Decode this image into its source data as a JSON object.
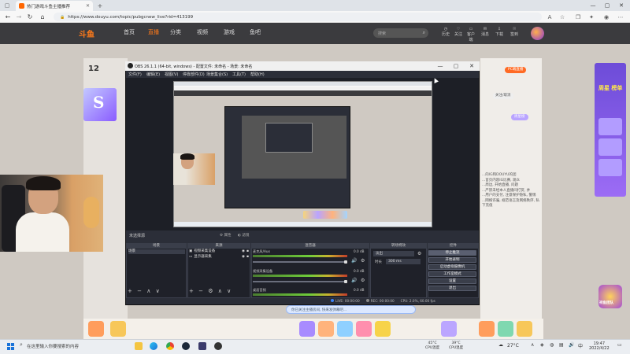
{
  "browser": {
    "tab_title": "热门游戏斗鱼主播推荐",
    "url": "https://www.douyu.com/topic/pubgcnew_live?rid=413199",
    "icons": [
      "back-icon",
      "forward-icon",
      "refresh-icon",
      "home-icon",
      "read-aloud-icon",
      "favorite-icon",
      "collections-icon",
      "extensions-icon",
      "profile-icon",
      "more-icon"
    ]
  },
  "douyu": {
    "logo": "斗鱼",
    "nav": [
      "首页",
      "直播",
      "分类",
      "视频",
      "游戏",
      "鱼吧"
    ],
    "search_placeholder": "搜索",
    "header_icons": [
      "历史",
      "关注",
      "客户端",
      "消息",
      "下载",
      "签到"
    ],
    "room_number": "12",
    "room_sub": "",
    "pc_live_label": "PC端直播",
    "follow_label": "关注/取消",
    "weekly_label": "周星榜",
    "rank_title": "周星 榜单",
    "side_text": [
      "...的IG和DOUYU的团",
      "...首页内容IG比赛, 观众",
      "...周边, 开始直播, 问题",
      "...严禁未经本人直播间打赏, 并",
      "...用户的支付, 注意保护隐私, 警惕",
      "...网络诈骗, 规范语言及网络秩序, 私下充值"
    ],
    "danmu_text": "你已关注主播房间, 快来发弹幕吧...",
    "badge_text": "祥鱼团队"
  },
  "obs": {
    "title": "OBS 26.1.1 (64-bit, windows) - 配置文件: 未命名 - 场景: 未命名",
    "menu": [
      "文件(F)",
      "编辑(E)",
      "视图(V)",
      "停靠部件(D)",
      "场景集合(S)",
      "工具(T)",
      "帮助(H)"
    ],
    "no_source": "未选择源",
    "properties_label": "属性",
    "filters_label": "滤镜",
    "docks": {
      "scenes": {
        "title": "场景",
        "items": [
          "场景"
        ]
      },
      "sources": {
        "title": "来源",
        "items": [
          "视频采集设备",
          "显示器采集"
        ]
      },
      "mixer": {
        "title": "混音器",
        "channels": [
          {
            "name": "麦克风/Aux",
            "db": "0.0 dB"
          },
          {
            "name": "视频采集设备",
            "db": "0.0 dB"
          },
          {
            "name": "桌面音频",
            "db": "0.0 dB"
          }
        ]
      },
      "transitions": {
        "title": "转场特效",
        "type": "淡出",
        "duration_label": "时长",
        "duration_value": "300 ms"
      },
      "controls": {
        "title": "控件",
        "buttons": [
          "停止推流",
          "开始录制",
          "启动虚拟摄像机",
          "工作室模式",
          "设置",
          "退出"
        ]
      }
    },
    "status": {
      "live": "LIVE: 00:00:00",
      "rec": "REC: 00:00:00",
      "cpu": "CPU: 2.0%, 60.00 fps"
    }
  },
  "taskbar": {
    "search_text": "在这里输入你要搜索的内容",
    "cpu_temp": {
      "value": "45°C",
      "label": "CPU温度"
    },
    "gpu_temp": {
      "value": "39°C",
      "label": "CPU温度"
    },
    "weather": "27°C",
    "time": "19:47",
    "date": "2022/4/22",
    "apps": [
      "file-explorer-icon",
      "edge-icon",
      "chrome-icon",
      "steam-icon",
      "obs-icon",
      "app-icon"
    ]
  },
  "colors": {
    "douyu_orange": "#ff7a1a",
    "obs_bg": "#2b2e38",
    "taskbar": "#ebeef2"
  }
}
